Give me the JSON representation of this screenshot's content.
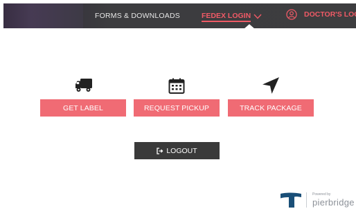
{
  "nav": {
    "forms_label": "FORMS & DOWNLOADS",
    "fedex_label": "FEDEX LOGIN",
    "doctor_label": "DOCTOR'S LOGIN"
  },
  "actions": {
    "get_label": "GET LABEL",
    "request_pickup": "REQUEST PICKUP",
    "track_package": "TRACK PACKAGE"
  },
  "logout": {
    "label": "LOGOUT"
  },
  "footer": {
    "powered_by": "Powered by",
    "brand": "pierbridge"
  },
  "colors": {
    "accent": "#f06b74",
    "nav_active": "#f05a66",
    "nav_bg": "#3d3d3f",
    "logout_bg": "#3a3a3a",
    "logo_blue": "#1a4f78"
  },
  "icons": {
    "truck": "truck-icon",
    "calendar": "calendar-icon",
    "navigation": "navigation-arrow-icon",
    "logout": "logout-icon",
    "user": "user-circle-icon",
    "chevron": "chevron-down-icon"
  }
}
